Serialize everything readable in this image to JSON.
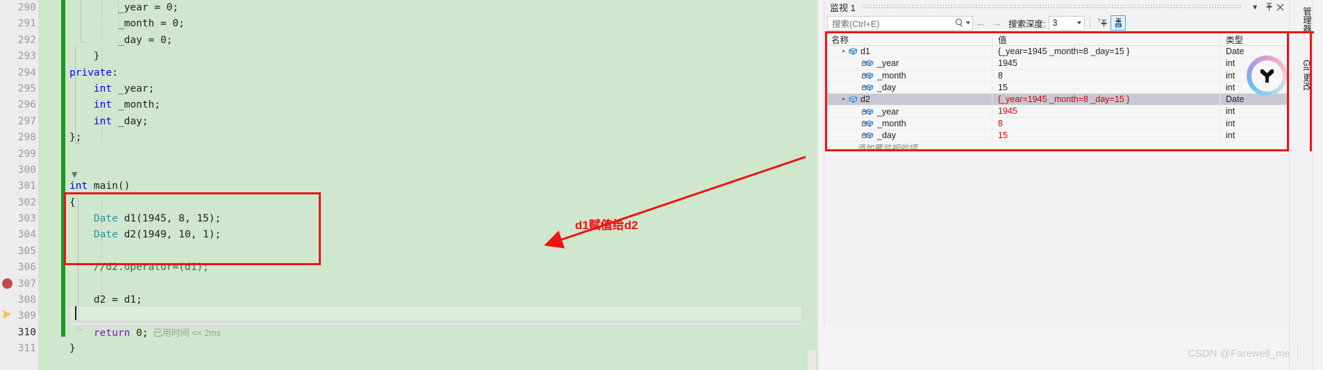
{
  "editor": {
    "language": "cpp",
    "lines": [
      {
        "num": "290",
        "indent": 4,
        "tokens": [
          {
            "t": "_year = 0;",
            "c": "pln"
          }
        ]
      },
      {
        "num": "291",
        "indent": 4,
        "tokens": [
          {
            "t": "_month = 0;",
            "c": "pln"
          }
        ]
      },
      {
        "num": "292",
        "indent": 4,
        "tokens": [
          {
            "t": "_day = 0;",
            "c": "pln"
          }
        ]
      },
      {
        "num": "293",
        "indent": 2,
        "tokens": [
          {
            "t": "}",
            "c": "pln"
          }
        ]
      },
      {
        "num": "294",
        "indent": 0,
        "tokens": [
          {
            "t": "private",
            "c": "kw"
          },
          {
            "t": ":",
            "c": "pln"
          }
        ]
      },
      {
        "num": "295",
        "indent": 2,
        "tokens": [
          {
            "t": "int",
            "c": "kw"
          },
          {
            "t": " _year;",
            "c": "pln"
          }
        ]
      },
      {
        "num": "296",
        "indent": 2,
        "tokens": [
          {
            "t": "int",
            "c": "kw"
          },
          {
            "t": " _month;",
            "c": "pln"
          }
        ]
      },
      {
        "num": "297",
        "indent": 2,
        "tokens": [
          {
            "t": "int",
            "c": "kw"
          },
          {
            "t": " _day;",
            "c": "pln"
          }
        ]
      },
      {
        "num": "298",
        "indent": 0,
        "tokens": [
          {
            "t": "};",
            "c": "pln"
          }
        ]
      },
      {
        "num": "299",
        "indent": 0,
        "tokens": []
      },
      {
        "num": "300",
        "indent": 0,
        "tokens": []
      },
      {
        "num": "301",
        "indent": 0,
        "tokens": [
          {
            "t": "int",
            "c": "kw"
          },
          {
            "t": " main()",
            "c": "pln"
          }
        ]
      },
      {
        "num": "302",
        "indent": 0,
        "tokens": [
          {
            "t": "{",
            "c": "pln"
          }
        ]
      },
      {
        "num": "303",
        "indent": 2,
        "tokens": [
          {
            "t": "Date",
            "c": "typ"
          },
          {
            "t": " d1(1945, 8, 15);",
            "c": "pln"
          }
        ]
      },
      {
        "num": "304",
        "indent": 2,
        "tokens": [
          {
            "t": "Date",
            "c": "typ"
          },
          {
            "t": " d2(1949, 10, 1);",
            "c": "pln"
          }
        ]
      },
      {
        "num": "305",
        "indent": 0,
        "tokens": []
      },
      {
        "num": "306",
        "indent": 2,
        "tokens": [
          {
            "t": "//d2.operator=(d1);",
            "c": "cmt"
          }
        ]
      },
      {
        "num": "307",
        "indent": 0,
        "tokens": []
      },
      {
        "num": "308",
        "indent": 2,
        "tokens": [
          {
            "t": "d2 = d1;",
            "c": "pln"
          }
        ]
      },
      {
        "num": "309",
        "indent": 0,
        "tokens": []
      },
      {
        "num": "310",
        "indent": 2,
        "current": true,
        "tokens": [
          {
            "t": "return",
            "c": "ret"
          },
          {
            "t": " 0;",
            "c": "pln"
          },
          {
            "t": "  已用时间",
            "c": "hint"
          },
          {
            "t": " <= 2ms",
            "c": "hint2"
          }
        ]
      },
      {
        "num": "311",
        "indent": 0,
        "tokens": [
          {
            "t": "}",
            "c": "pln"
          }
        ]
      }
    ],
    "elapsed_hint": "已用时间 <= 2ms",
    "breakpoint_line": "308",
    "current_statement_line": "310"
  },
  "annotation": {
    "text": "d1赋值给d2",
    "color": "#f01111"
  },
  "watch": {
    "title": "监视 1",
    "titlebar_buttons": [
      "chevron-down",
      "pin",
      "close"
    ],
    "search": {
      "placeholder": "搜索(Ctrl+E)",
      "value": ""
    },
    "depth_label": "搜索深度:",
    "depth_value": "3",
    "columns": [
      "名称",
      "值",
      "类型"
    ],
    "rows": [
      {
        "name": "d1",
        "level": 0,
        "expanded": true,
        "icon": "object-icon",
        "value": "{_year=1945 _month=8 _day=15 }",
        "type": "Date",
        "changed": false,
        "selected": false
      },
      {
        "name": "_year",
        "level": 1,
        "expanded": false,
        "icon": "field-private-icon",
        "value": "1945",
        "type": "int",
        "changed": false,
        "selected": false
      },
      {
        "name": "_month",
        "level": 1,
        "expanded": false,
        "icon": "field-private-icon",
        "value": "8",
        "type": "int",
        "changed": false,
        "selected": false
      },
      {
        "name": "_day",
        "level": 1,
        "expanded": false,
        "icon": "field-private-icon",
        "value": "15",
        "type": "int",
        "changed": false,
        "selected": false
      },
      {
        "name": "d2",
        "level": 0,
        "expanded": true,
        "icon": "object-icon",
        "value": "{_year=1945 _month=8 _day=15 }",
        "type": "Date",
        "changed": true,
        "selected": true
      },
      {
        "name": "_year",
        "level": 1,
        "expanded": false,
        "icon": "field-private-icon",
        "value": "1945",
        "type": "int",
        "changed": true,
        "selected": false
      },
      {
        "name": "_month",
        "level": 1,
        "expanded": false,
        "icon": "field-private-icon",
        "value": "8",
        "type": "int",
        "changed": true,
        "selected": false
      },
      {
        "name": "_day",
        "level": 1,
        "expanded": false,
        "icon": "field-private-icon",
        "value": "15",
        "type": "int",
        "changed": true,
        "selected": false
      }
    ],
    "add_watch_placeholder": "添加要监视的项"
  },
  "right_strip": {
    "tabs": [
      "管理器",
      "Git 更改"
    ]
  },
  "watermark": "CSDN @Farewell_me"
}
